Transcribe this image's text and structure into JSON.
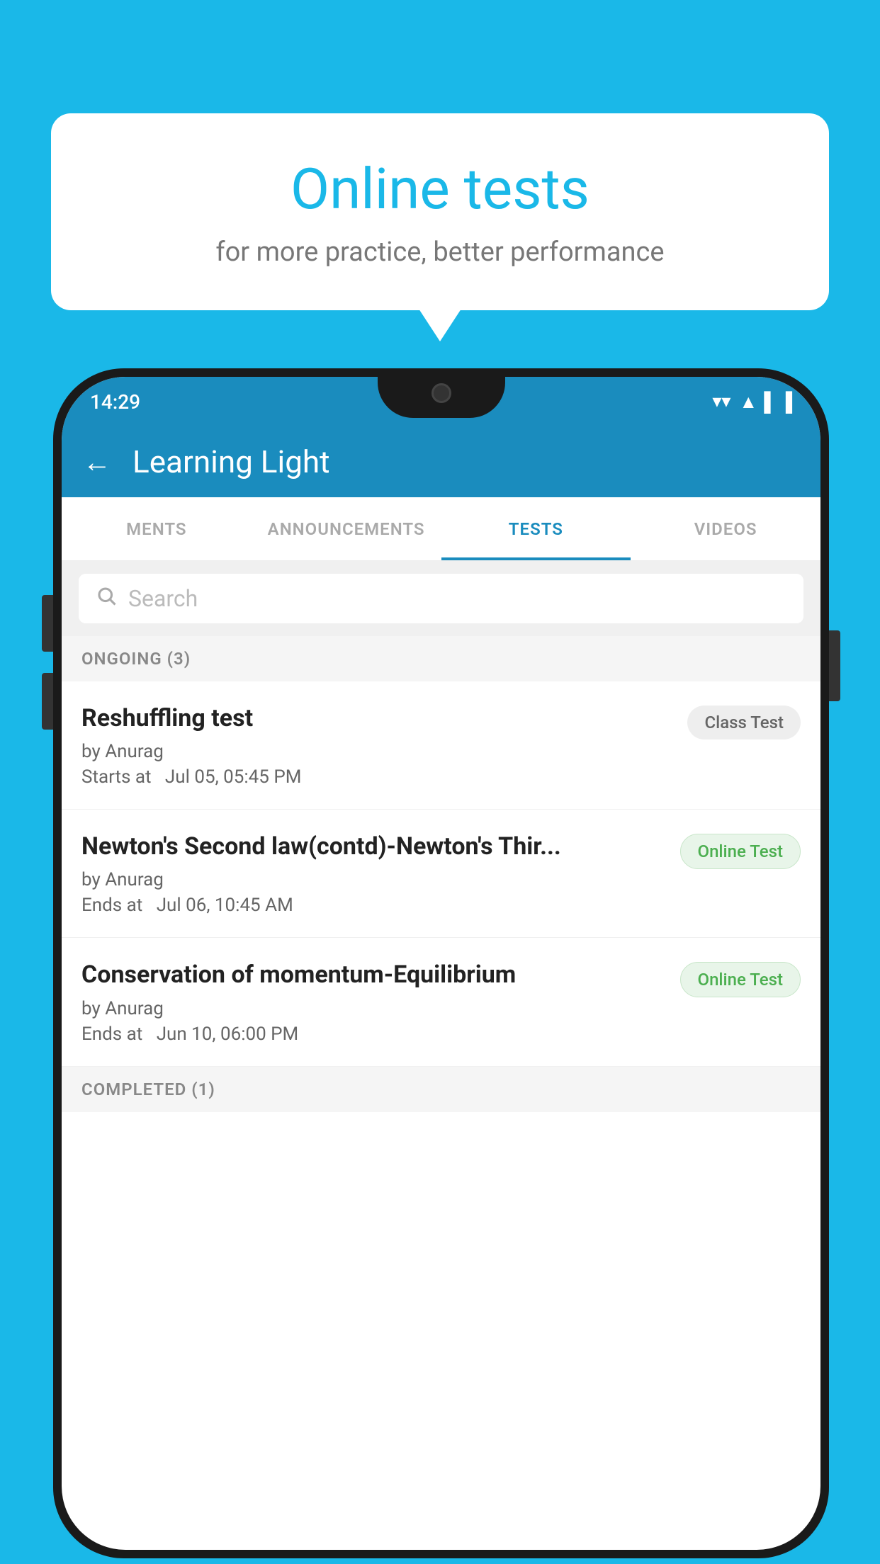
{
  "background": {
    "color": "#1ab8e8"
  },
  "speech_bubble": {
    "title": "Online tests",
    "subtitle": "for more practice, better performance"
  },
  "phone": {
    "status_bar": {
      "time": "14:29",
      "wifi": "▼",
      "signal": "▲",
      "battery": "▐"
    },
    "header": {
      "title": "Learning Light",
      "back_label": "←"
    },
    "tabs": [
      {
        "label": "MENTS",
        "active": false
      },
      {
        "label": "ANNOUNCEMENTS",
        "active": false
      },
      {
        "label": "TESTS",
        "active": true
      },
      {
        "label": "VIDEOS",
        "active": false
      }
    ],
    "search": {
      "placeholder": "Search"
    },
    "ongoing_section": {
      "label": "ONGOING (3)"
    },
    "tests": [
      {
        "title": "Reshuffling test",
        "author": "by Anurag",
        "time_label": "Starts at",
        "time_value": "Jul 05, 05:45 PM",
        "badge": "Class Test",
        "badge_type": "class"
      },
      {
        "title": "Newton's Second law(contd)-Newton's Thir...",
        "author": "by Anurag",
        "time_label": "Ends at",
        "time_value": "Jul 06, 10:45 AM",
        "badge": "Online Test",
        "badge_type": "online"
      },
      {
        "title": "Conservation of momentum-Equilibrium",
        "author": "by Anurag",
        "time_label": "Ends at",
        "time_value": "Jun 10, 06:00 PM",
        "badge": "Online Test",
        "badge_type": "online"
      }
    ],
    "completed_section": {
      "label": "COMPLETED (1)"
    }
  }
}
